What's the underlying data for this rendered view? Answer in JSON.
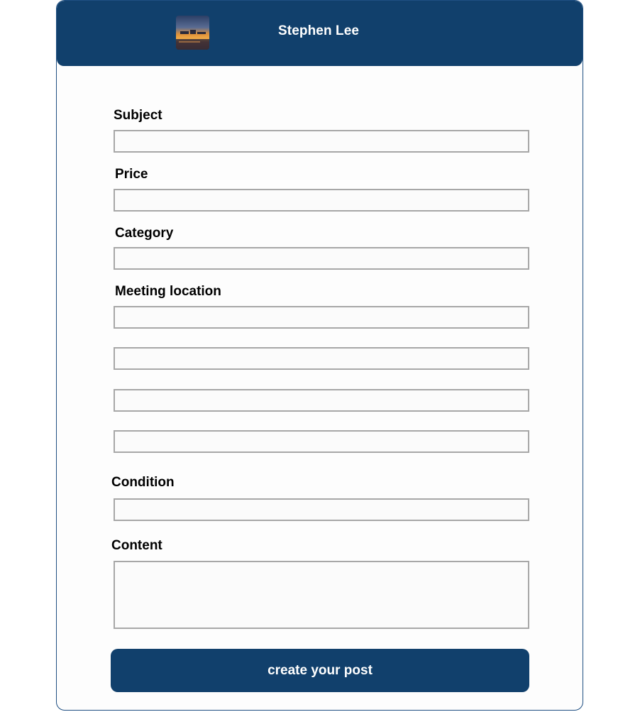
{
  "header": {
    "username": "Stephen Lee",
    "avatar_icon": "sunset-photo-avatar"
  },
  "form": {
    "subject_label": "Subject",
    "subject_value": "",
    "price_label": "Price",
    "price_value": "",
    "category_label": "Category",
    "category_value": "",
    "meeting_location_label": "Meeting location",
    "meeting_location_values": [
      "",
      "",
      "",
      ""
    ],
    "condition_label": "Condition",
    "condition_value": "",
    "content_label": "Content",
    "content_value": "",
    "submit_label": "create your post"
  },
  "colors": {
    "header_bg": "#11406c",
    "button_bg": "#11406c",
    "card_border": "#1f4f82",
    "field_border": "#a7a7a7"
  }
}
